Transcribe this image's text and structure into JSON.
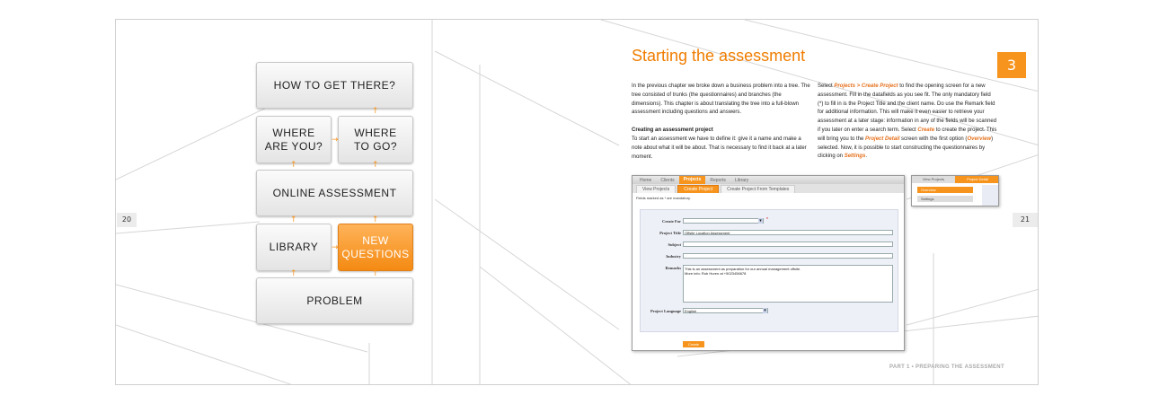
{
  "left_page": {
    "page_number": "20",
    "boxes": {
      "top": "HOW TO GET THERE?",
      "where_are": "WHERE\nARE YOU?",
      "where_to": "WHERE\nTO GO?",
      "online": "ONLINE ASSESSMENT",
      "library": "LIBRARY",
      "new_questions": "NEW\nQUESTIONS",
      "problem": "PROBLEM"
    }
  },
  "right_page": {
    "page_number": "21",
    "chapter_number": "3",
    "title": "Starting the assessment",
    "col1_p1": "In the previous chapter we broke down a business problem into a tree. The tree consisted of trunks (the questionnaires) and branches (the dimensions). This chapter is about translating the tree into a full-blown assessment including questions and answers.",
    "col1_heading": "Creating an assessment project",
    "col1_p2": "To start an assessment we have to define it: give it a name and make a note about what it will be about. That is necessary to find it back at a later moment.",
    "col2": {
      "t1": "Select ",
      "l1": "Projects > Create Project",
      "t2": " to find the opening screen for a new assessment. Fill in the datafields as you see fit. The only mandatory field (*) to fill in is the Project Title and the client name. Do use the Remark field for additional information. This will make it even easier to retrieve your assessment at a later stage: information in any of the fields will be scanned if you later on enter a search term. Select ",
      "l2": "Create",
      "t3": " to create the project. This will bring you to the ",
      "l3": "Project Detail",
      "t4": " screen with the first option (",
      "l4": "Overview",
      "t5": ") selected. Now, it is possible to start constructing the questionnaires by clicking on ",
      "l5": "Settings",
      "t6": "."
    },
    "footer": "PART 1 • PREPARING THE ASSESSMENT"
  },
  "screenshot": {
    "nav": [
      "Home",
      "Clients",
      "Projects",
      "Reports",
      "Library"
    ],
    "subnav": [
      "View Projects",
      "Create Project",
      "Create Project From Templates"
    ],
    "note": "Fields marked as * are mandatory.",
    "labels": {
      "create_for": "Create For",
      "project_title": "Project Title",
      "subject": "Subject",
      "industry": "Industry",
      "remarks": "Remarks",
      "language": "Project Language"
    },
    "values": {
      "project_title": "Offsite Location Assessment",
      "remarks_line1": "This is an assessment as preparation for our annual management offsite.",
      "remarks_line2": "More info: Rob Huren at +5023456678",
      "language": "English"
    },
    "mandatory_mark": "*",
    "create_button": "Create"
  },
  "mini_shot": {
    "tab1": "View Projects",
    "tab2": "Project Detail",
    "item1": "Overview",
    "item2": "Settings"
  },
  "colors": {
    "accent": "#f7941d"
  }
}
